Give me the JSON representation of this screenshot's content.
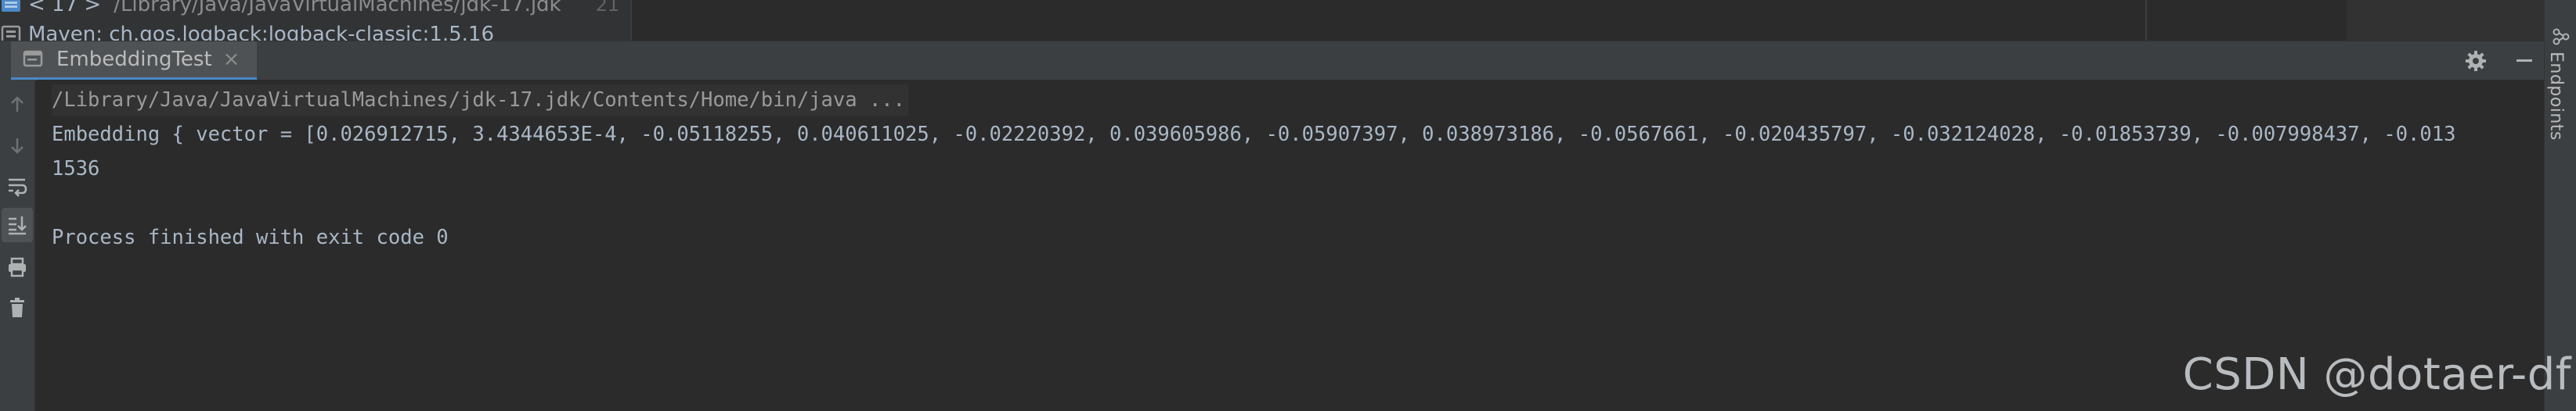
{
  "editor_strip": {
    "jdk_version": "< 17 >",
    "jdk_path": "/Library/Java/JavaVirtualMachines/jdk-17.jdk",
    "line_number": "21",
    "maven_library": "Maven: ch.qos.logback:logback-classic:1.5.16"
  },
  "run_window": {
    "tab_label": "EmbeddingTest",
    "settings_icon": "gear-icon",
    "minimize_icon": "minus-icon",
    "side_panel_label": "Endpoints",
    "colors": {
      "accent": "#4a88c7",
      "console_text": "#a9b7c6",
      "command_text": "#9a9a9a",
      "background": "#2b2b2b",
      "panel": "#3c3f41"
    }
  },
  "toolbar": {
    "items": [
      {
        "name": "up-arrow-icon"
      },
      {
        "name": "down-arrow-icon"
      },
      {
        "name": "soft-wrap-icon"
      },
      {
        "name": "scroll-to-end-icon"
      },
      {
        "name": "print-icon"
      },
      {
        "name": "trash-icon"
      }
    ]
  },
  "console": {
    "command": "/Library/Java/JavaVirtualMachines/jdk-17.jdk/Contents/Home/bin/java ...",
    "output_line": "Embedding { vector = [0.026912715, 3.4344653E-4, -0.05118255, 0.040611025, -0.02220392, 0.039605986, -0.05907397, 0.038973186, -0.0567661, -0.020435797, -0.032124028, -0.01853739, -0.007998437, -0.013",
    "dimension": "1536",
    "exit_message": "Process finished with exit code 0"
  },
  "watermark": "CSDN @dotaer-df"
}
